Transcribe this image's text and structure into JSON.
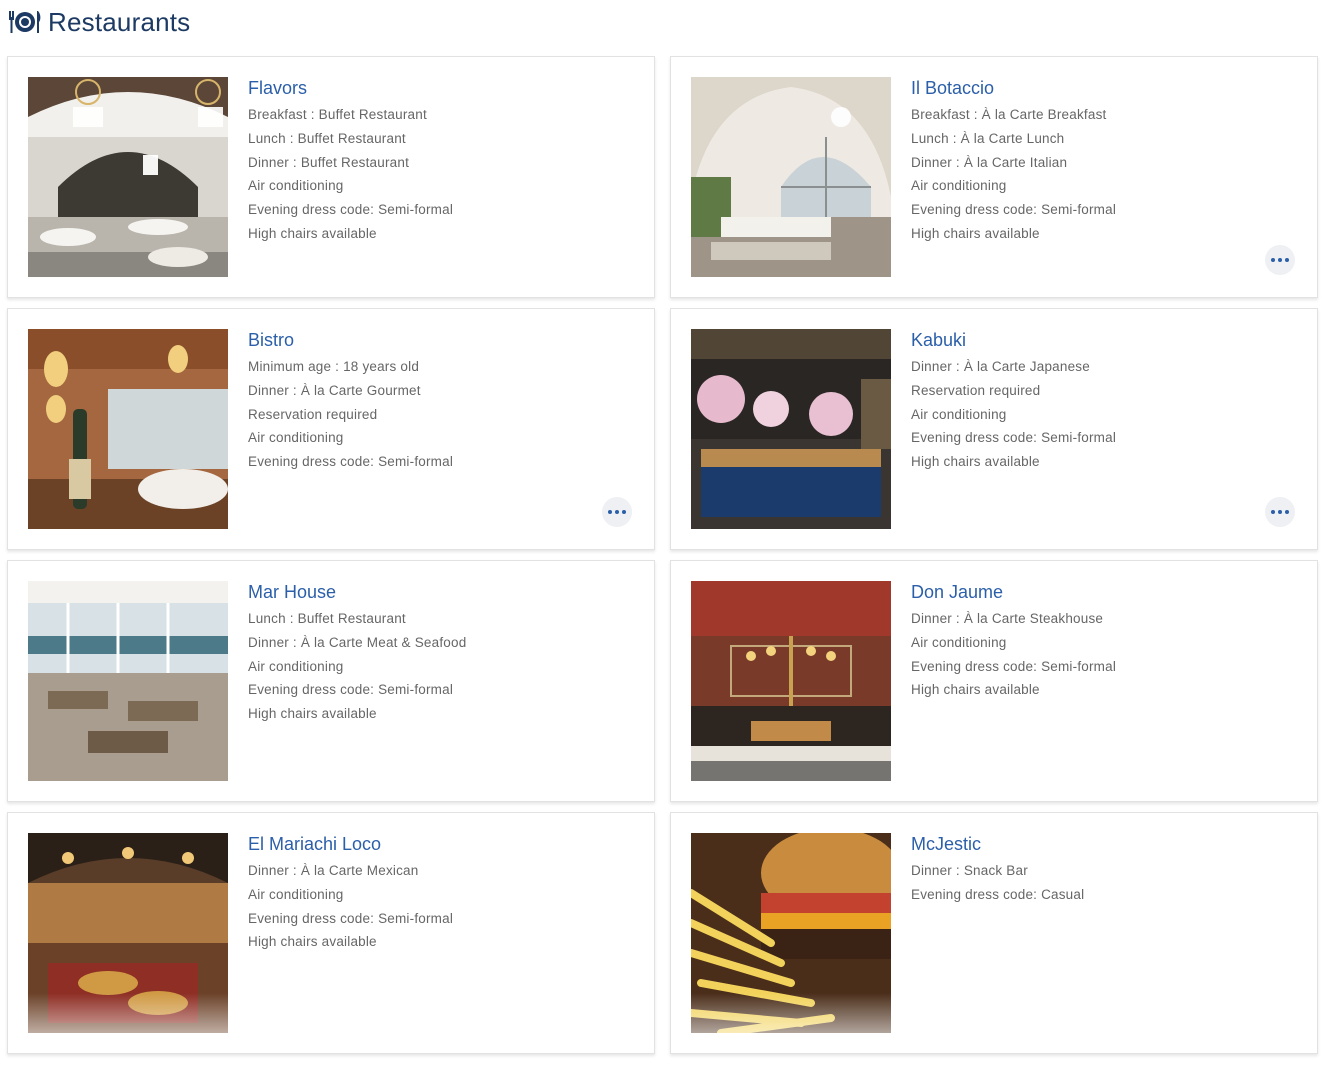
{
  "header": {
    "title": "Restaurants",
    "icon": "dining-icon"
  },
  "restaurants": [
    {
      "name": "Flavors",
      "photo": "flavors-photo",
      "more": false,
      "details": [
        "Breakfast : Buffet Restaurant",
        "Lunch : Buffet Restaurant",
        "Dinner : Buffet Restaurant",
        "Air conditioning",
        "Evening dress code: Semi-formal",
        "High chairs available"
      ]
    },
    {
      "name": "Il Botaccio",
      "photo": "il-botaccio-photo",
      "more": true,
      "details": [
        "Breakfast : À la Carte Breakfast",
        "Lunch : À la Carte Lunch",
        "Dinner : À la Carte Italian",
        "Air conditioning",
        "Evening dress code: Semi-formal",
        "High chairs available"
      ]
    },
    {
      "name": "Bistro",
      "photo": "bistro-photo",
      "more": true,
      "details": [
        "Minimum age : 18 years old",
        "Dinner : À la Carte Gourmet",
        "Reservation required",
        "Air conditioning",
        "Evening dress code: Semi-formal"
      ]
    },
    {
      "name": "Kabuki",
      "photo": "kabuki-photo",
      "more": true,
      "details": [
        "Dinner : À la Carte Japanese",
        "Reservation required",
        "Air conditioning",
        "Evening dress code: Semi-formal",
        "High chairs available"
      ]
    },
    {
      "name": "Mar House",
      "photo": "mar-house-photo",
      "more": false,
      "details": [
        "Lunch : Buffet Restaurant",
        "Dinner : À la Carte Meat & Seafood",
        "Air conditioning",
        "Evening dress code: Semi-formal",
        "High chairs available"
      ]
    },
    {
      "name": "Don Jaume",
      "photo": "don-jaume-photo",
      "more": false,
      "details": [
        "Dinner : À la Carte Steakhouse",
        "Air conditioning",
        "Evening dress code: Semi-formal",
        "High chairs available"
      ]
    },
    {
      "name": "El Mariachi Loco",
      "photo": "el-mariachi-loco-photo",
      "more": false,
      "details": [
        "Dinner : À la Carte Mexican",
        "Air conditioning",
        "Evening dress code: Semi-formal",
        "High chairs available"
      ]
    },
    {
      "name": "McJestic",
      "photo": "mcjestic-photo",
      "more": false,
      "details": [
        "Dinner : Snack Bar",
        "Evening dress code: Casual"
      ]
    }
  ],
  "colors": {
    "title": "#1c3a63",
    "link": "#2b5fa9",
    "text": "#666666"
  }
}
